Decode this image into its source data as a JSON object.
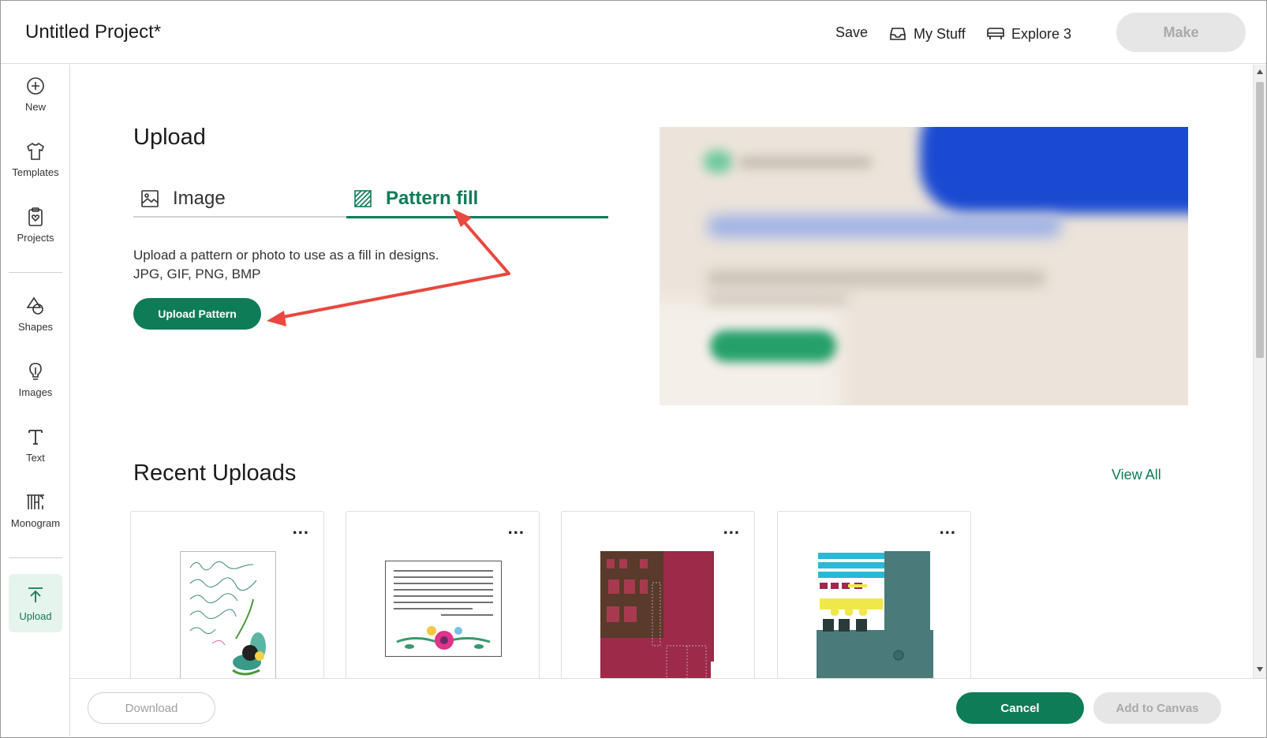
{
  "header": {
    "project_title": "Untitled Project*",
    "save_label": "Save",
    "my_stuff_label": "My Stuff",
    "machine_label": "Explore 3",
    "make_label": "Make"
  },
  "sidebar": {
    "items": [
      {
        "label": "New",
        "icon": "plus-circle-icon"
      },
      {
        "label": "Templates",
        "icon": "shirt-icon"
      },
      {
        "label": "Projects",
        "icon": "clipboard-heart-icon"
      },
      {
        "label": "Shapes",
        "icon": "shapes-icon"
      },
      {
        "label": "Images",
        "icon": "lightbulb-icon"
      },
      {
        "label": "Text",
        "icon": "text-t-icon"
      },
      {
        "label": "Monogram",
        "icon": "monogram-icon"
      },
      {
        "label": "Upload",
        "icon": "upload-arrow-icon",
        "active": true
      }
    ]
  },
  "upload": {
    "title": "Upload",
    "tabs": [
      {
        "label": "Image",
        "icon": "image-icon",
        "active": false
      },
      {
        "label": "Pattern fill",
        "icon": "pattern-fill-icon",
        "active": true
      }
    ],
    "description_line1": "Upload a pattern or photo to use as a fill in designs.",
    "description_line2": "JPG, GIF, PNG, BMP",
    "upload_button_label": "Upload Pattern"
  },
  "recent": {
    "title": "Recent Uploads",
    "view_all_label": "View All",
    "more_label": "...",
    "cards": [
      {
        "kind": "calligraphy-print"
      },
      {
        "kind": "floral-quote-print"
      },
      {
        "kind": "red-house-papercraft"
      },
      {
        "kind": "teal-house-papercraft"
      }
    ]
  },
  "footer": {
    "download_label": "Download",
    "cancel_label": "Cancel",
    "add_to_canvas_label": "Add to Canvas"
  },
  "colors": {
    "accent": "#0e7c57",
    "annotation_arrow": "#e8483f",
    "disabled_bg": "#e6e6e6",
    "disabled_text": "#a9a9a9"
  }
}
